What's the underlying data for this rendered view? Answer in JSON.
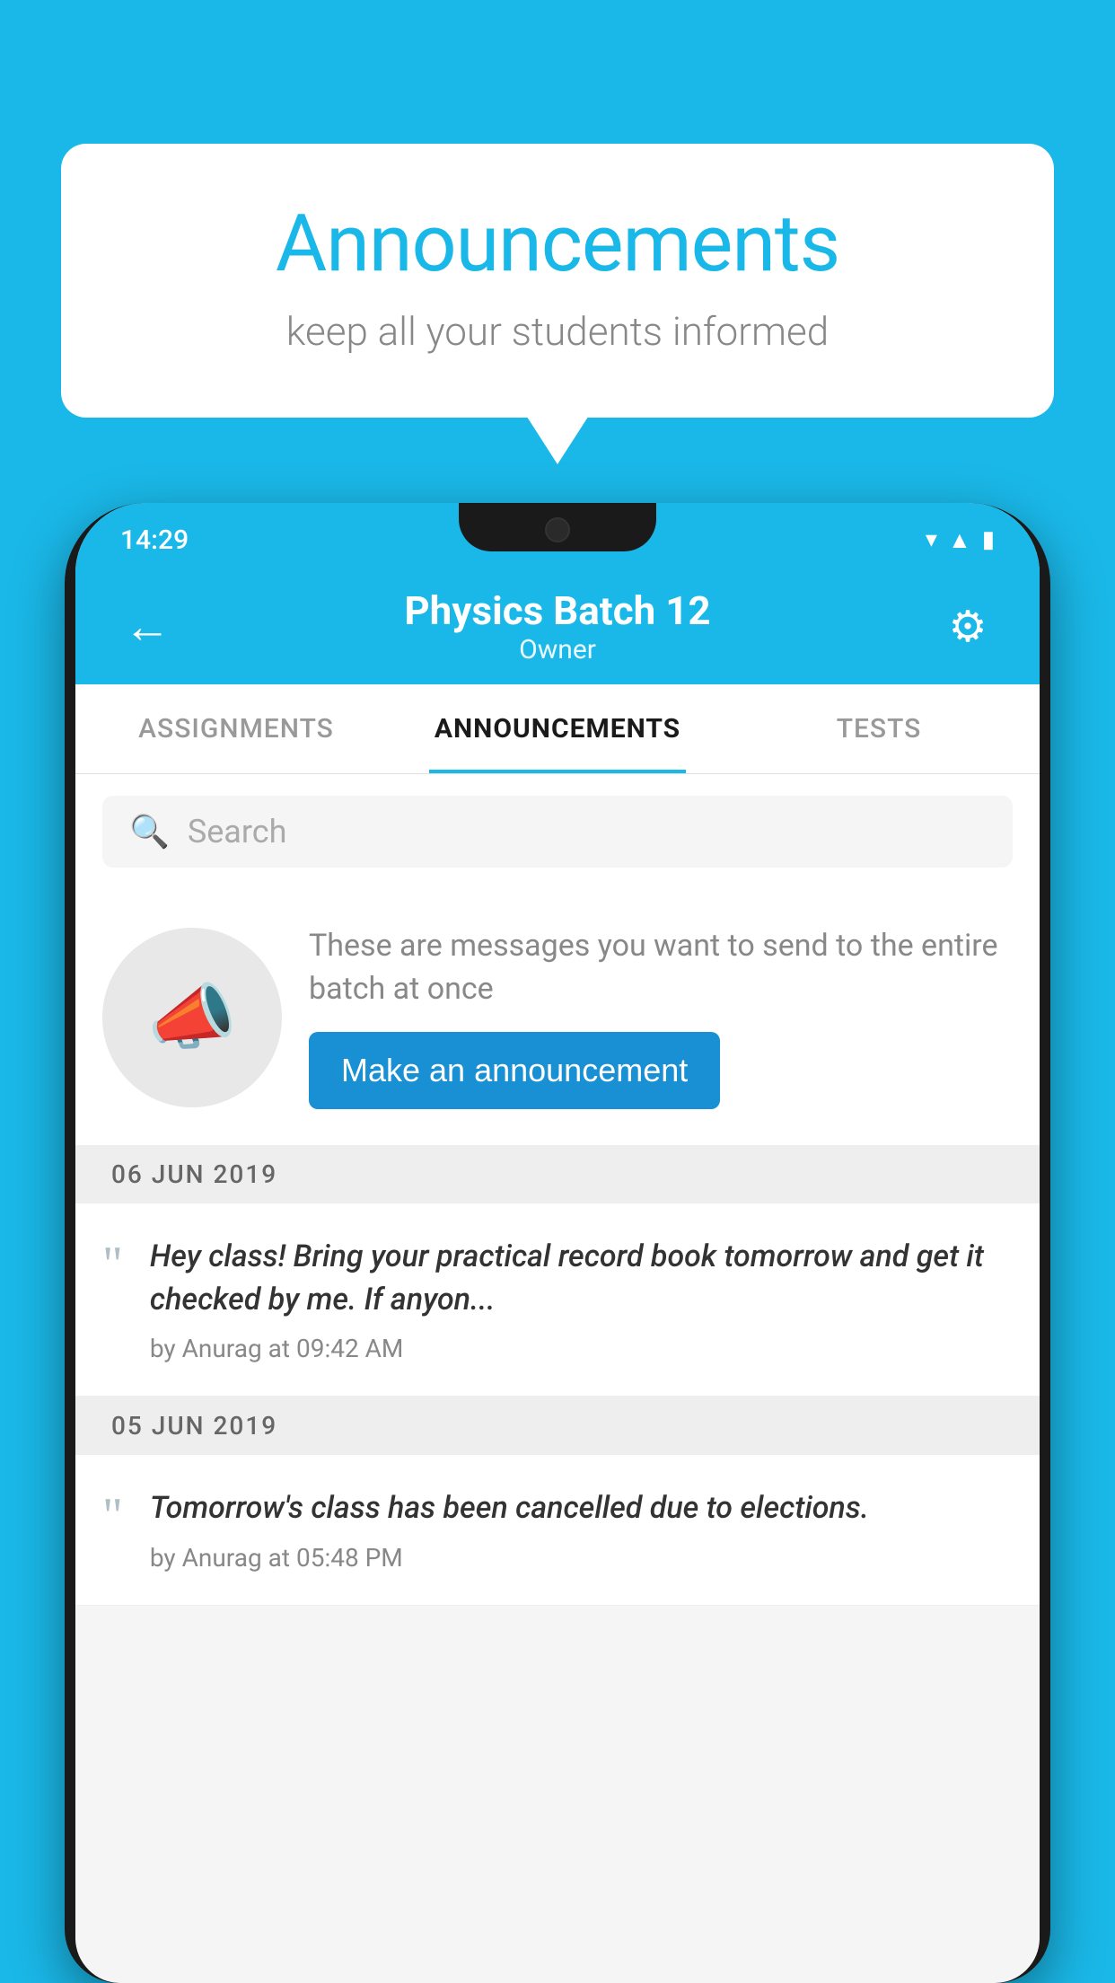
{
  "background_color": "#1ab8e8",
  "speech_bubble": {
    "title": "Announcements",
    "subtitle": "keep all your students informed"
  },
  "status_bar": {
    "time": "14:29",
    "icons": [
      "wifi",
      "signal",
      "battery"
    ]
  },
  "app_bar": {
    "title": "Physics Batch 12",
    "subtitle": "Owner",
    "back_label": "←",
    "gear_label": "⚙"
  },
  "tabs": [
    {
      "label": "ASSIGNMENTS",
      "active": false
    },
    {
      "label": "ANNOUNCEMENTS",
      "active": true
    },
    {
      "label": "TESTS",
      "active": false
    }
  ],
  "search": {
    "placeholder": "Search"
  },
  "promo": {
    "description": "These are messages you want to send to the entire batch at once",
    "button_label": "Make an announcement"
  },
  "announcements": [
    {
      "date": "06  JUN  2019",
      "text": "Hey class! Bring your practical record book tomorrow and get it checked by me. If anyon...",
      "meta": "by Anurag at 09:42 AM"
    },
    {
      "date": "05  JUN  2019",
      "text": "Tomorrow's class has been cancelled due to elections.",
      "meta": "by Anurag at 05:48 PM"
    }
  ]
}
